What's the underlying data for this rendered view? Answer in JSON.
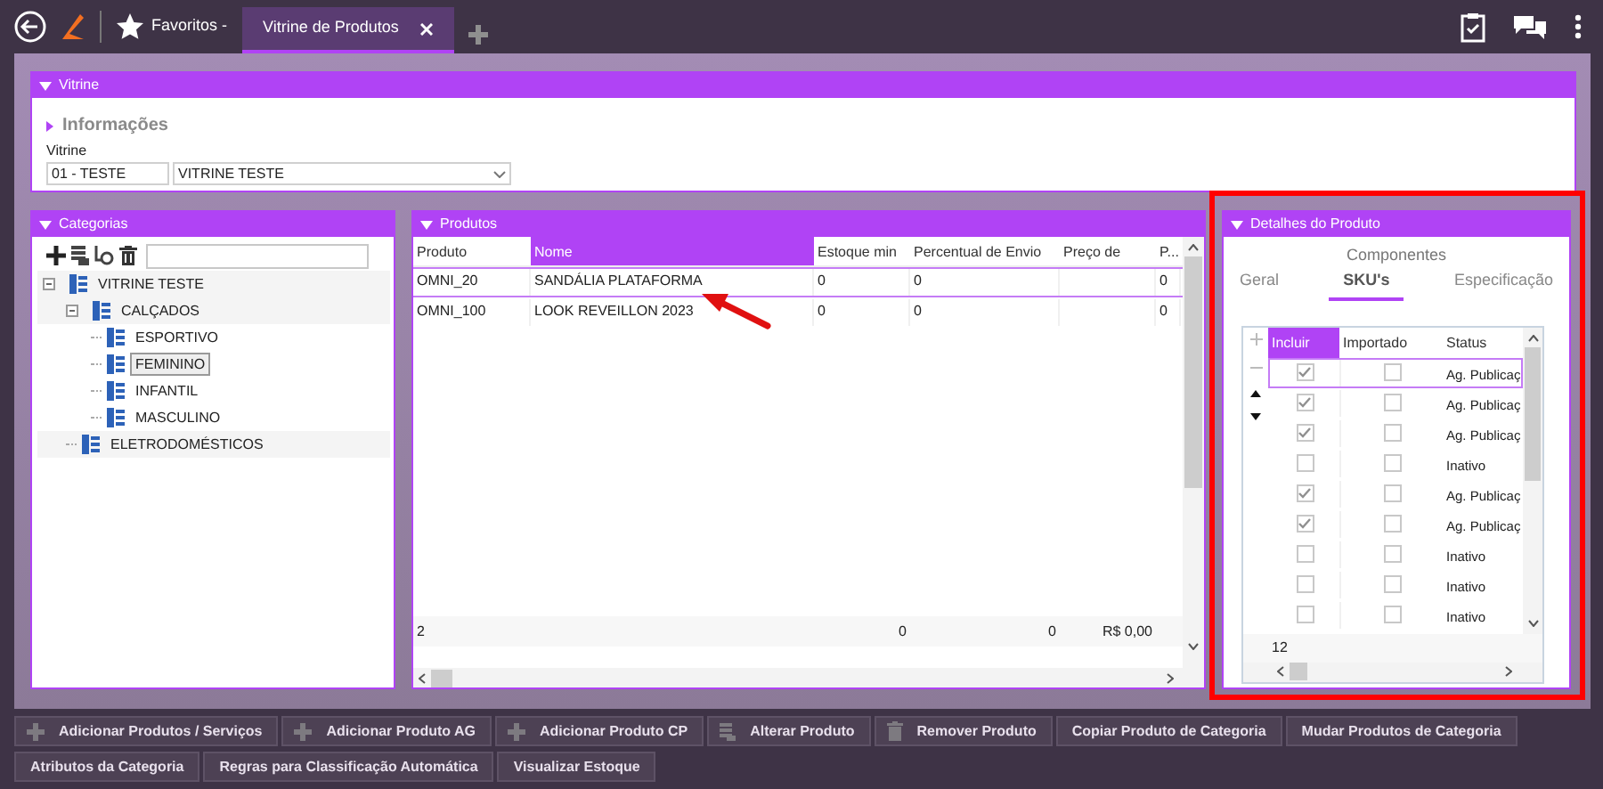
{
  "topbar": {
    "favorites": "Favoritos -",
    "tabs": [
      {
        "label": "Vitrine de Produtos",
        "selected": true
      }
    ]
  },
  "vitrine": {
    "title": "Vitrine",
    "section": "Informações",
    "field_label": "Vitrine",
    "code": "01 - TESTE",
    "value": "VITRINE TESTE"
  },
  "categories": {
    "title": "Categorias",
    "tree": [
      {
        "label": "VITRINE TESTE",
        "expanded": true,
        "selected": false,
        "children": [
          {
            "label": "CALÇADOS",
            "expanded": true,
            "selected": false,
            "children": [
              {
                "label": "ESPORTIVO",
                "selected": false
              },
              {
                "label": "FEMININO",
                "selected": true
              },
              {
                "label": "INFANTIL",
                "selected": false
              },
              {
                "label": "MASCULINO",
                "selected": false
              }
            ]
          },
          {
            "label": "ELETRODOMÉSTICOS",
            "selected": false
          }
        ]
      }
    ]
  },
  "products": {
    "title": "Produtos",
    "columns": [
      {
        "label": "Produto",
        "selected": false
      },
      {
        "label": "Nome",
        "selected": true
      },
      {
        "label": "Estoque min",
        "selected": false
      },
      {
        "label": "Percentual de Envio",
        "selected": false
      },
      {
        "label": "Preço de",
        "selected": false
      },
      {
        "label": "P...",
        "selected": false
      }
    ],
    "rows": [
      {
        "cells": [
          "OMNI_20",
          "SANDÁLIA PLATAFORMA",
          "0",
          "0",
          "",
          "0"
        ],
        "selected": true
      },
      {
        "cells": [
          "OMNI_100",
          "LOOK REVEILLON 2023",
          "0",
          "0",
          "",
          "0"
        ],
        "selected": false
      }
    ],
    "footer": {
      "produto": "2",
      "estoque_min": "0",
      "percentual": "0",
      "preco": "R$ 0,00"
    }
  },
  "details": {
    "title": "Detalhes do Produto",
    "group": "Componentes",
    "tabs": [
      {
        "label": "Geral",
        "selected": false
      },
      {
        "label": "SKU's",
        "selected": true
      },
      {
        "label": "Especificação",
        "selected": false
      }
    ],
    "columns": [
      {
        "label": "Incluir",
        "selected": true
      },
      {
        "label": "Importado",
        "selected": false
      },
      {
        "label": "Status",
        "selected": false
      }
    ],
    "rows": [
      {
        "incluir": true,
        "importado": false,
        "status": "Ag. Publicaç",
        "selected": true
      },
      {
        "incluir": true,
        "importado": false,
        "status": "Ag. Publicaç",
        "selected": false
      },
      {
        "incluir": true,
        "importado": false,
        "status": "Ag. Publicaç",
        "selected": false
      },
      {
        "incluir": false,
        "importado": false,
        "status": "Inativo",
        "selected": false
      },
      {
        "incluir": true,
        "importado": false,
        "status": "Ag. Publicaç",
        "selected": false
      },
      {
        "incluir": true,
        "importado": false,
        "status": "Ag. Publicaç",
        "selected": false
      },
      {
        "incluir": false,
        "importado": false,
        "status": "Inativo",
        "selected": false
      },
      {
        "incluir": false,
        "importado": false,
        "status": "Inativo",
        "selected": false
      },
      {
        "incluir": false,
        "importado": false,
        "status": "Inativo",
        "selected": false
      }
    ],
    "footer": "12"
  },
  "actions": [
    [
      {
        "label": "Adicionar Produtos / Serviços",
        "kind": "plus"
      },
      {
        "label": "Adicionar Produto AG",
        "kind": "plus"
      },
      {
        "label": "Adicionar Produto CP",
        "kind": "plus"
      },
      {
        "label": "Alterar Produto",
        "kind": "edit"
      },
      {
        "label": "Remover Produto",
        "kind": "trash"
      },
      {
        "label": "Copiar Produto de Categoria",
        "kind": "plain"
      },
      {
        "label": "Mudar Produtos de Categoria",
        "kind": "plain"
      }
    ],
    [
      {
        "label": "Atributos da Categoria",
        "kind": "plain"
      },
      {
        "label": "Regras para Classificação Automática",
        "kind": "plain"
      },
      {
        "label": "Visualizar Estoque",
        "kind": "plain"
      }
    ]
  ]
}
